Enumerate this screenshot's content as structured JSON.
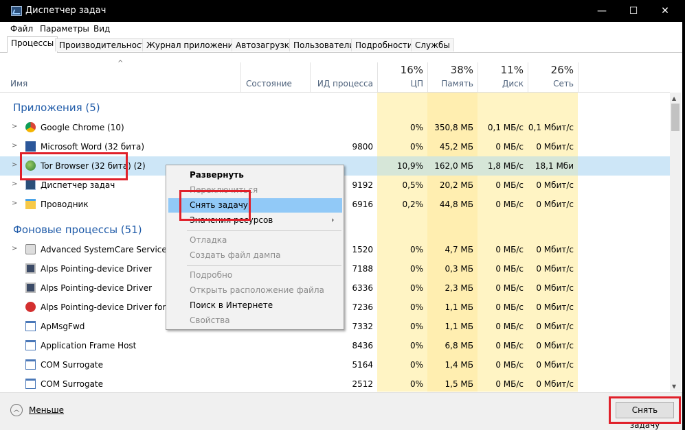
{
  "window": {
    "title": "Диспетчер задач",
    "minimize": "—",
    "maximize": "☐",
    "close": "✕"
  },
  "menu": [
    "Файл",
    "Параметры",
    "Вид"
  ],
  "tabs": [
    "Процессы",
    "Производительность",
    "Журнал приложений",
    "Автозагрузка",
    "Пользователи",
    "Подробности",
    "Службы"
  ],
  "header": {
    "name": "Имя",
    "status": "Состояние",
    "pid": "ИД процесса",
    "cpu": {
      "pct": "16%",
      "label": "ЦП"
    },
    "mem": {
      "pct": "38%",
      "label": "Память"
    },
    "disk": {
      "pct": "11%",
      "label": "Диск"
    },
    "net": {
      "pct": "26%",
      "label": "Сеть"
    }
  },
  "groups": {
    "apps": "Приложения (5)",
    "background": "Фоновые процессы (51)"
  },
  "apps": [
    {
      "name": "Google Chrome (10)",
      "pid": "",
      "cpu": "0%",
      "mem": "350,8 МБ",
      "disk": "0,1 МБ/с",
      "net": "0,1 Мбит/с",
      "icon": "chrome-icon"
    },
    {
      "name": "Microsoft Word (32 бита)",
      "pid": "9800",
      "cpu": "0%",
      "mem": "45,2 МБ",
      "disk": "0 МБ/с",
      "net": "0 Мбит/с",
      "icon": "word-icon"
    },
    {
      "name": "Tor Browser (32 бита) (2)",
      "pid": "",
      "cpu": "10,9%",
      "mem": "162,0 МБ",
      "disk": "1,8 МБ/с",
      "net": "18,1 Мби",
      "icon": "tor-globe-icon"
    },
    {
      "name": "Диспетчер задач",
      "pid": "9192",
      "cpu": "0,5%",
      "mem": "20,2 МБ",
      "disk": "0 МБ/с",
      "net": "0 Мбит/с",
      "icon": "taskmgr-icon"
    },
    {
      "name": "Проводник",
      "pid": "6916",
      "cpu": "0,2%",
      "mem": "44,8 МБ",
      "disk": "0 МБ/с",
      "net": "0 Мбит/с",
      "icon": "explorer-folder-icon"
    }
  ],
  "background": [
    {
      "name": "Advanced SystemCare Service (32 б",
      "pid": "1520",
      "cpu": "0%",
      "mem": "4,7 МБ",
      "disk": "0 МБ/с",
      "net": "0 Мбит/с",
      "icon": "service-icon"
    },
    {
      "name": "Alps Pointing-device Driver",
      "pid": "7188",
      "cpu": "0%",
      "mem": "0,3 МБ",
      "disk": "0 МБ/с",
      "net": "0 Мбит/с",
      "icon": "monitor-icon"
    },
    {
      "name": "Alps Pointing-device Driver",
      "pid": "6336",
      "cpu": "0%",
      "mem": "2,3 МБ",
      "disk": "0 МБ/с",
      "net": "0 Мбит/с",
      "icon": "monitor-icon"
    },
    {
      "name": "Alps Pointing-device Driver for Wir",
      "pid": "7236",
      "cpu": "0%",
      "mem": "1,1 МБ",
      "disk": "0 МБ/с",
      "net": "0 Мбит/с",
      "icon": "apple-icon"
    },
    {
      "name": "ApMsgFwd",
      "pid": "7332",
      "cpu": "0%",
      "mem": "1,1 МБ",
      "disk": "0 МБ/с",
      "net": "0 Мбит/с",
      "icon": "window-icon"
    },
    {
      "name": "Application Frame Host",
      "pid": "8436",
      "cpu": "0%",
      "mem": "6,8 МБ",
      "disk": "0 МБ/с",
      "net": "0 Мбит/с",
      "icon": "window-icon"
    },
    {
      "name": "COM Surrogate",
      "pid": "5164",
      "cpu": "0%",
      "mem": "1,4 МБ",
      "disk": "0 МБ/с",
      "net": "0 Мбит/с",
      "icon": "window-icon"
    },
    {
      "name": "COM Surrogate",
      "pid": "2512",
      "cpu": "0%",
      "mem": "1,5 МБ",
      "disk": "0 МБ/с",
      "net": "0 Мбит/с",
      "icon": "window-icon"
    }
  ],
  "context_menu": {
    "expand": "Развернуть",
    "switch_to": "Переключиться",
    "end_task": "Снять задачу",
    "resource_values": "Значения ресурсов",
    "debug": "Отладка",
    "create_dump": "Создать файл дампа",
    "details": "Подробно",
    "open_location": "Открыть расположение файла",
    "search_online": "Поиск в Интернете",
    "properties": "Свойства"
  },
  "footer": {
    "fewer_details": "Меньше",
    "end_task": "Снять задачу"
  },
  "colors": {
    "accent_highlight": "#e0202a",
    "selection": "#cde6f7",
    "metric_bg": "#fff4c4",
    "group_text": "#1e5aa8"
  }
}
